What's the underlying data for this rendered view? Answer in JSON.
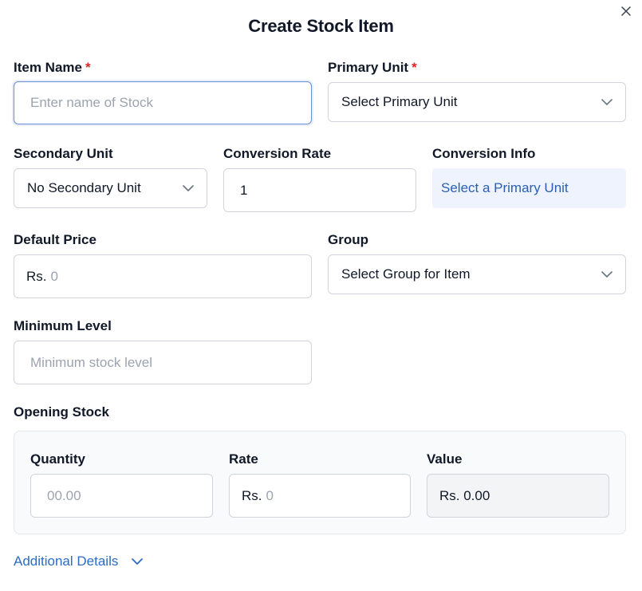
{
  "dialog": {
    "title": "Create Stock Item"
  },
  "fields": {
    "item_name": {
      "label": "Item Name",
      "required_mark": "*",
      "placeholder": "Enter name of Stock"
    },
    "primary_unit": {
      "label": "Primary Unit",
      "required_mark": "*",
      "value": "Select Primary Unit"
    },
    "secondary_unit": {
      "label": "Secondary Unit",
      "value": "No Secondary Unit"
    },
    "conversion_rate": {
      "label": "Conversion Rate",
      "value": "1"
    },
    "conversion_info": {
      "label": "Conversion Info",
      "value": "Select a Primary Unit"
    },
    "default_price": {
      "label": "Default Price",
      "prefix": "Rs.",
      "placeholder": "0"
    },
    "group": {
      "label": "Group",
      "value": "Select Group for Item"
    },
    "minimum_level": {
      "label": "Minimum Level",
      "placeholder": "Minimum stock level"
    }
  },
  "opening_stock": {
    "label": "Opening Stock",
    "quantity": {
      "label": "Quantity",
      "placeholder": "00.00"
    },
    "rate": {
      "label": "Rate",
      "prefix": "Rs.",
      "placeholder": "0"
    },
    "value": {
      "label": "Value",
      "value": "Rs. 0.00"
    }
  },
  "additional_details": {
    "label": "Additional Details"
  },
  "colors": {
    "required": "#dc2626",
    "link": "#2b6cc4",
    "info_bg": "#eef3fd",
    "focus_border": "#6b8fd6"
  },
  "icons": {
    "close": "close-icon",
    "dropdown": "chevron-down-icon"
  }
}
